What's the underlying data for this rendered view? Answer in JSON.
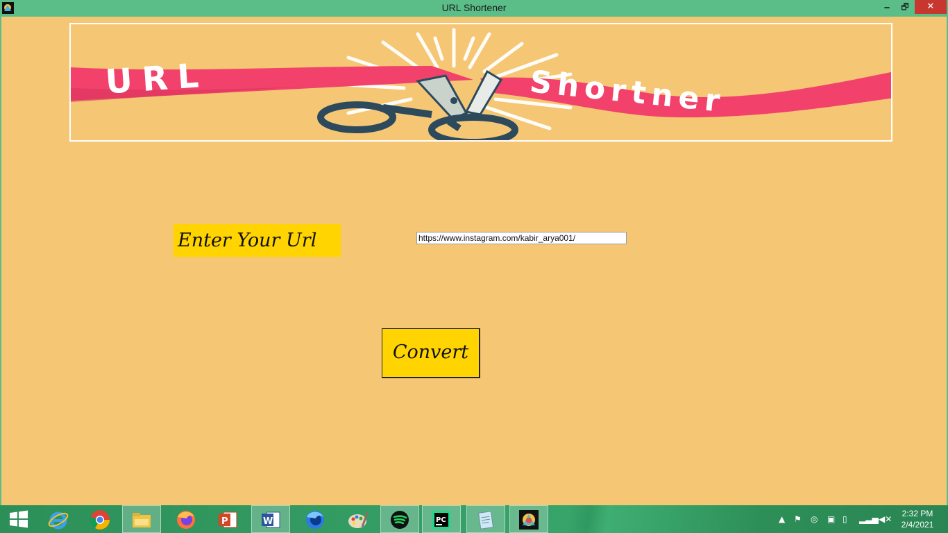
{
  "window": {
    "title": "URL Shortener",
    "minimize_label": "🗕",
    "maximize_label": "🗗",
    "close_label": "✕"
  },
  "banner": {
    "left_text": "URL",
    "right_text": "Shortner"
  },
  "form": {
    "label": "Enter Your Url",
    "input_value": "https://www.instagram.com/kabir_arya001/",
    "button_label": "Convert"
  },
  "taskbar": {
    "apps": [
      {
        "name": "start-icon"
      },
      {
        "name": "internet-explorer-icon"
      },
      {
        "name": "chrome-icon"
      },
      {
        "name": "file-explorer-icon"
      },
      {
        "name": "firefox-icon"
      },
      {
        "name": "powerpoint-icon"
      },
      {
        "name": "word-icon"
      },
      {
        "name": "firefox-dev-icon"
      },
      {
        "name": "paint-icon"
      },
      {
        "name": "spotify-icon"
      },
      {
        "name": "pycharm-icon"
      },
      {
        "name": "notepad-icon"
      },
      {
        "name": "url-shortener-app-icon"
      }
    ],
    "time": "2:32 PM",
    "date": "2/4/2021"
  },
  "colors": {
    "background": "#f5c775",
    "titlebar": "#5bbd88",
    "label_bg": "#ffd400",
    "ribbon": "#f2426b",
    "taskbar": "#2c8f58"
  }
}
